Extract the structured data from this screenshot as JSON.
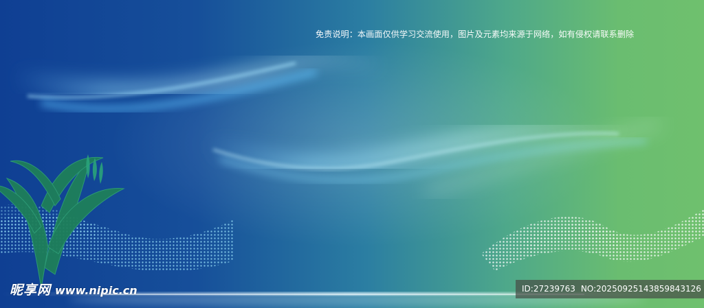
{
  "disclaimer": "免责说明：本画面仅供学习交流使用，图片及元素均来源于网络，如有侵权请联系删除",
  "watermark": {
    "brand_cn": "昵享网",
    "url": "www.nipic.cn"
  },
  "image_id": {
    "id": "ID:27239763",
    "no": "NO:20250925143859843126"
  },
  "colors": {
    "left": "#0f3f93",
    "middle": "#2b7ea2",
    "right": "#6fc06e"
  },
  "decor": [
    "plant-icon",
    "light-wave",
    "dot-wave"
  ]
}
